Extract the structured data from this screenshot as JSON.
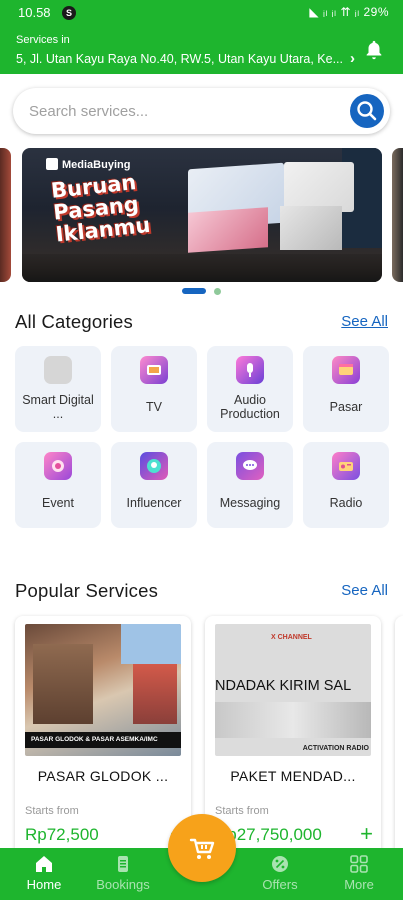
{
  "status_bar": {
    "time": "10.58",
    "badge": "S",
    "indicators": "◣ ᵢₗ ᵢₗ ⇈ ᵢₗ 29%"
  },
  "header": {
    "label": "Services in",
    "address": "5, Jl. Utan Kayu Raya No.40, RW.5, Utan Kayu Utara, Ke...",
    "chevron": "›",
    "bell_icon": "bell-icon"
  },
  "search": {
    "placeholder": "Search services...",
    "icon": "search-icon"
  },
  "banner": {
    "logo": "MediaBuying",
    "headline_line1": "Buruan",
    "headline_line2": "Pasang",
    "headline_line3": "Iklanmu"
  },
  "categories": {
    "title": "All Categories",
    "see_all": "See All",
    "items": [
      {
        "label": "Smart Digital ...",
        "icon": "smart-digital-icon",
        "color": "#d9d9d9"
      },
      {
        "label": "TV",
        "icon": "tv-icon",
        "color": "#c94fb3"
      },
      {
        "label": "Audio Production",
        "icon": "audio-production-icon",
        "color": "#b65ad6"
      },
      {
        "label": "Pasar",
        "icon": "pasar-icon",
        "color": "#d65ab0"
      },
      {
        "label": "Event",
        "icon": "event-icon",
        "color": "#c85dc6"
      },
      {
        "label": "Influencer",
        "icon": "influencer-icon",
        "color": "#7a4fd6"
      },
      {
        "label": "Messaging",
        "icon": "messaging-icon",
        "color": "#9a4fd0"
      },
      {
        "label": "Radio",
        "icon": "radio-icon",
        "color": "#c94fc0"
      }
    ]
  },
  "popular": {
    "title": "Popular Services",
    "see_all": "See All",
    "items": [
      {
        "title": "PASAR GLODOK ...",
        "starts_from": "Starts from",
        "price": "Rp72,500",
        "image_caption": "PASAR GLODOK & PASAR ASEMKA/IMC"
      },
      {
        "title": "PAKET MENDAD...",
        "starts_from": "Starts from",
        "price": "Rp27,750,000",
        "image_caption": "NDADAK KIRIM SAL",
        "image_brand": "X CHANNEL",
        "image_footer": "ACTIVATION RADIO"
      }
    ]
  },
  "bottom_nav": {
    "items": [
      {
        "label": "Home",
        "icon": "home-icon",
        "active": true
      },
      {
        "label": "Bookings",
        "icon": "bookings-icon",
        "active": false
      },
      {
        "label": "Offers",
        "icon": "offers-icon",
        "active": false
      },
      {
        "label": "More",
        "icon": "more-icon",
        "active": false
      }
    ],
    "cart_icon": "cart-icon"
  }
}
